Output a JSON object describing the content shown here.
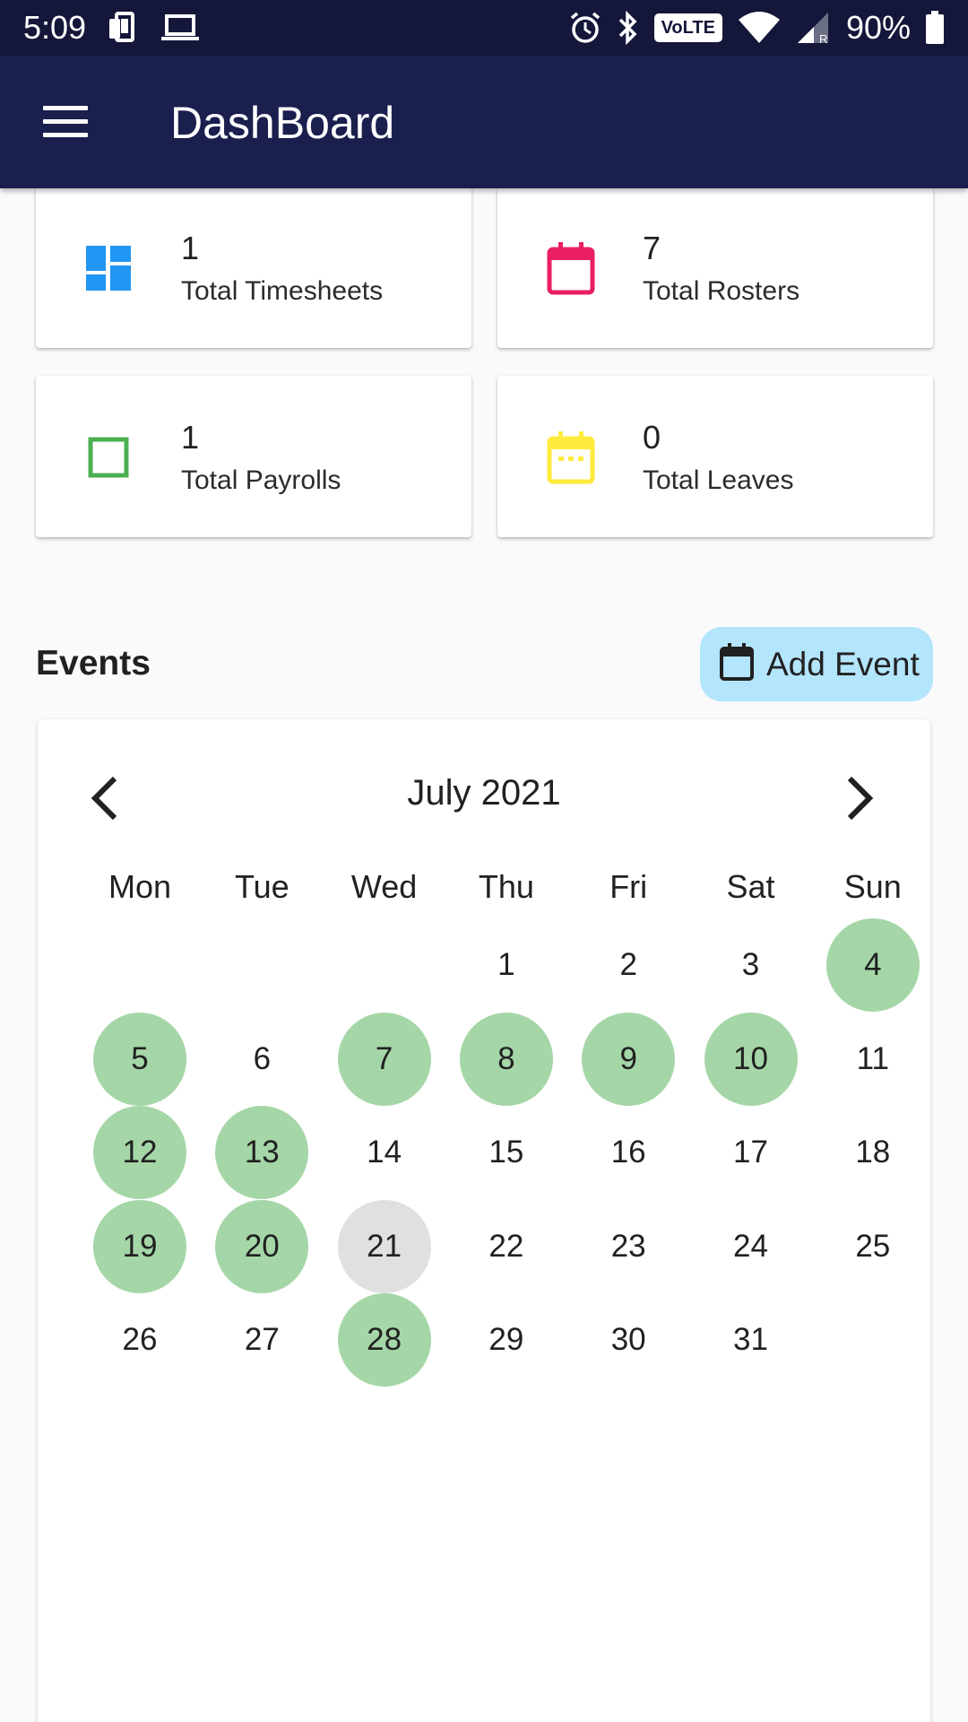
{
  "status_bar": {
    "time": "5:09",
    "volte": "VoLTE",
    "battery": "90%"
  },
  "app_bar": {
    "title": "DashBoard",
    "menu_icon": "menu-icon"
  },
  "stats": [
    {
      "count": "1",
      "label": "Total Timesheets",
      "icon": "dashboard-icon",
      "color": "#2196f3"
    },
    {
      "count": "7",
      "label": "Total Rosters",
      "icon": "calendar-icon",
      "color": "#e91e63"
    },
    {
      "count": "1",
      "label": "Total Payrolls",
      "icon": "square-outline-icon",
      "color": "#4caf50"
    },
    {
      "count": "0",
      "label": "Total Leaves",
      "icon": "calendar-dots-icon",
      "color": "#ffeb3b"
    }
  ],
  "events": {
    "title": "Events",
    "add_button_label": "Add Event",
    "add_button_icon": "calendar-icon"
  },
  "calendar": {
    "month_label": "July 2021",
    "prev_icon": "chevron-left-icon",
    "next_icon": "chevron-right-icon",
    "weekdays": [
      "Mon",
      "Tue",
      "Wed",
      "Thu",
      "Fri",
      "Sat",
      "Sun"
    ],
    "first_day_column": 3,
    "days_in_month": 31,
    "event_days": [
      4,
      5,
      7,
      8,
      9,
      10,
      12,
      13,
      19,
      20,
      28
    ],
    "today": 21,
    "colors": {
      "event": "#a5d6a7",
      "today": "#e0e0e0"
    }
  }
}
